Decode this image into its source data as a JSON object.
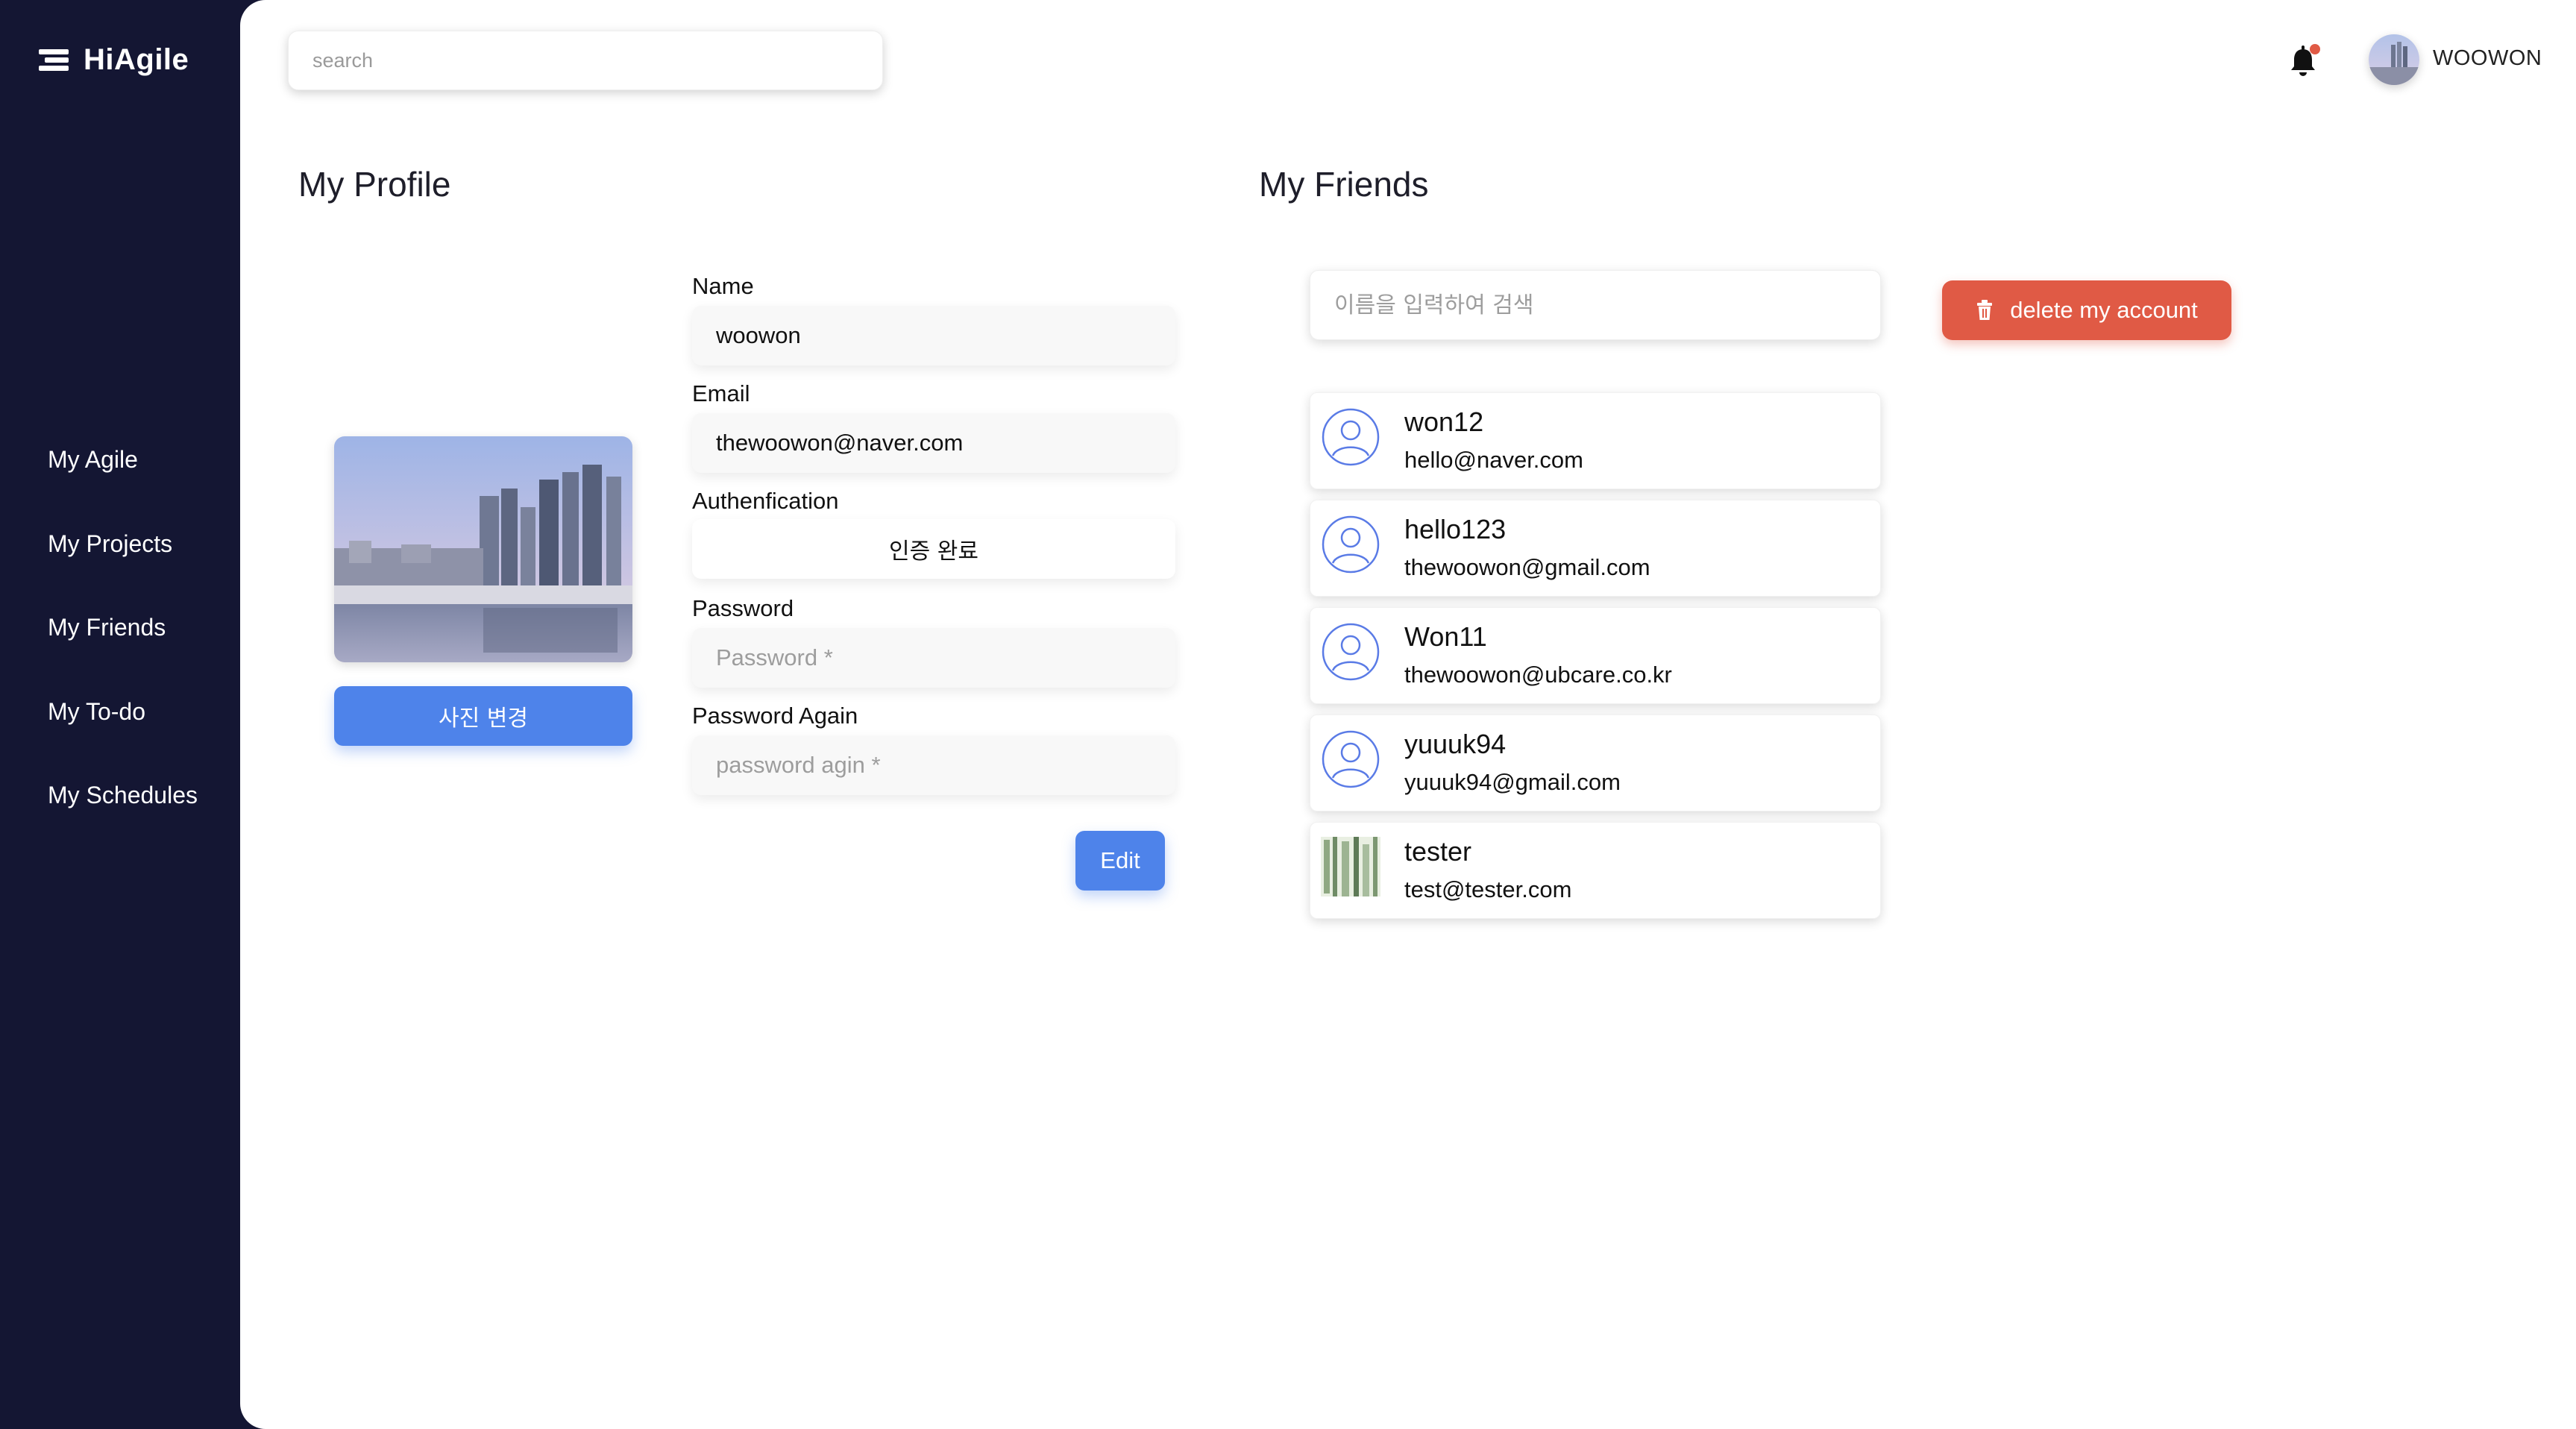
{
  "app": {
    "name": "HiAgile"
  },
  "sidebar": {
    "items": [
      {
        "label": "My Agile"
      },
      {
        "label": "My Projects"
      },
      {
        "label": "My Friends"
      },
      {
        "label": "My To-do"
      },
      {
        "label": "My Schedules"
      }
    ]
  },
  "header": {
    "search_placeholder": "search",
    "notification_dot_color": "#e05a45",
    "username": "WOOWON"
  },
  "profile": {
    "title": "My Profile",
    "change_photo_label": "사진 변경",
    "name_label": "Name",
    "name_value": "woowon",
    "email_label": "Email",
    "email_value": "thewoowon@naver.com",
    "auth_label": "Authenfication",
    "auth_value": "인증 완료",
    "password_label": "Password",
    "password_placeholder": "Password *",
    "password_again_label": "Password Again",
    "password_again_placeholder": "password agin *",
    "edit_label": "Edit"
  },
  "friends": {
    "title": "My Friends",
    "search_placeholder": "이름을 입력하여 검색",
    "delete_label": "delete my account",
    "list": [
      {
        "name": "won12",
        "email": "hello@naver.com",
        "avatar": "user-outline-icon"
      },
      {
        "name": "hello123",
        "email": "thewoowon@gmail.com",
        "avatar": "user-outline-icon"
      },
      {
        "name": "Won11",
        "email": "thewoowon@ubcare.co.kr",
        "avatar": "user-outline-icon"
      },
      {
        "name": "yuuuk94",
        "email": "yuuuk94@gmail.com",
        "avatar": "user-outline-icon"
      },
      {
        "name": "tester",
        "email": "test@tester.com",
        "avatar": "photo-thumbnail"
      }
    ]
  },
  "colors": {
    "sidebar": "#141633",
    "primary": "#4e83ea",
    "danger": "#e05a45"
  }
}
